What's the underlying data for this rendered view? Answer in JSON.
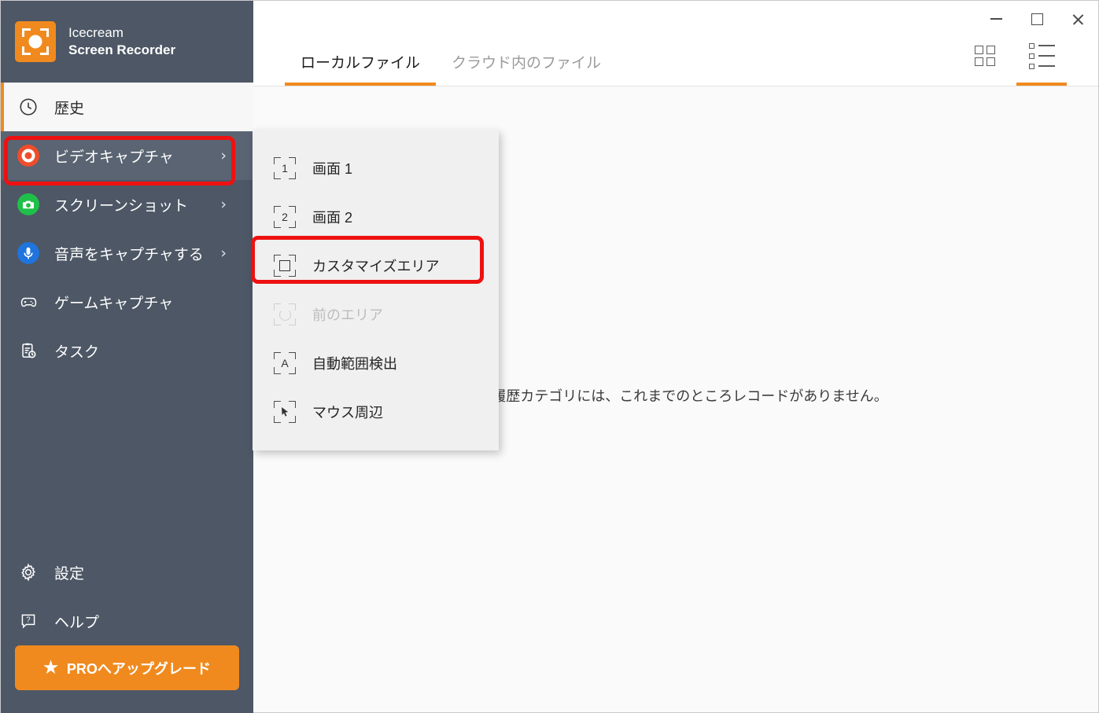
{
  "app": {
    "brand_line1": "Icecream",
    "brand_line2": "Screen Recorder",
    "accent_color": "#f08a1e",
    "sidebar_color": "#4d5765",
    "highlight_color": "#ee1111"
  },
  "window_controls": {
    "minimize_label": "Minimize",
    "maximize_label": "Maximize",
    "close_label": "Close"
  },
  "sidebar": {
    "items": [
      {
        "label": "歴史",
        "icon": "clock-icon",
        "state": "active",
        "chevron": ""
      },
      {
        "label": "ビデオキャプチャ",
        "icon": "record-icon",
        "state": "highlighted",
        "chevron": "›"
      },
      {
        "label": "スクリーンショット",
        "icon": "camera-icon",
        "state": "normal",
        "chevron": "›"
      },
      {
        "label": "音声をキャプチャする",
        "icon": "microphone-icon",
        "state": "normal",
        "chevron": "›"
      },
      {
        "label": "ゲームキャプチャ",
        "icon": "gamepad-icon",
        "state": "normal",
        "chevron": ""
      },
      {
        "label": "タスク",
        "icon": "clipboard-clock-icon",
        "state": "normal",
        "chevron": ""
      }
    ],
    "bottom_items": [
      {
        "label": "設定",
        "icon": "gear-icon"
      },
      {
        "label": "ヘルプ",
        "icon": "help-icon"
      }
    ],
    "upgrade": {
      "label": "PROへアップグレード",
      "icon": "star-icon",
      "star": "★"
    }
  },
  "main": {
    "tabs": [
      {
        "label": "ローカルファイル",
        "active": true
      },
      {
        "label": "クラウド内のファイル",
        "active": false
      }
    ],
    "view_toggles": [
      {
        "name": "grid-view",
        "active": false
      },
      {
        "name": "list-view",
        "active": true
      }
    ],
    "empty_message": "この履歴カテゴリには、これまでのところレコードがありません。"
  },
  "flyout_menu": {
    "items": [
      {
        "label": "画面 1",
        "icon": "capture-screen1-icon",
        "glyph": "1",
        "disabled": false,
        "highlighted": false
      },
      {
        "label": "画面 2",
        "icon": "capture-screen2-icon",
        "glyph": "2",
        "disabled": false,
        "highlighted": false
      },
      {
        "label": "カスタマイズエリア",
        "icon": "capture-area-icon",
        "glyph": "square",
        "disabled": false,
        "highlighted": true
      },
      {
        "label": "前のエリア",
        "icon": "capture-previous-icon",
        "glyph": "refresh",
        "disabled": true,
        "highlighted": false
      },
      {
        "label": "自動範囲検出",
        "icon": "capture-auto-icon",
        "glyph": "A",
        "disabled": false,
        "highlighted": false
      },
      {
        "label": "マウス周辺",
        "icon": "capture-mouse-icon",
        "glyph": "cursor",
        "disabled": false,
        "highlighted": false
      }
    ]
  }
}
